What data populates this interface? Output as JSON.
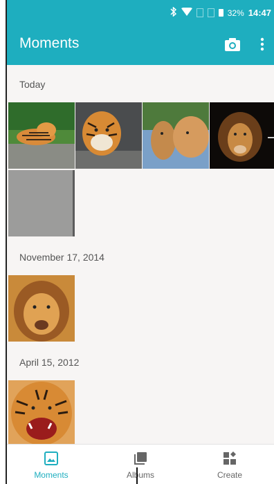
{
  "status_bar": {
    "battery_percent": "32%",
    "time": "14:47"
  },
  "app_bar": {
    "title": "Moments"
  },
  "sections": [
    {
      "label": "Today",
      "photos": [
        "tigers on rock",
        "tiger portrait",
        "lion cub",
        "lion portrait",
        "grey blank photo"
      ]
    },
    {
      "label": "November 17, 2014",
      "photos": [
        "lion face"
      ]
    },
    {
      "label": "April 15, 2012",
      "photos": [
        "roaring tiger"
      ]
    }
  ],
  "bottom_nav": {
    "moments": "Moments",
    "albums": "Albums",
    "create": "Create"
  },
  "colors": {
    "accent": "#1eaebf",
    "background": "#f7f5f4"
  }
}
